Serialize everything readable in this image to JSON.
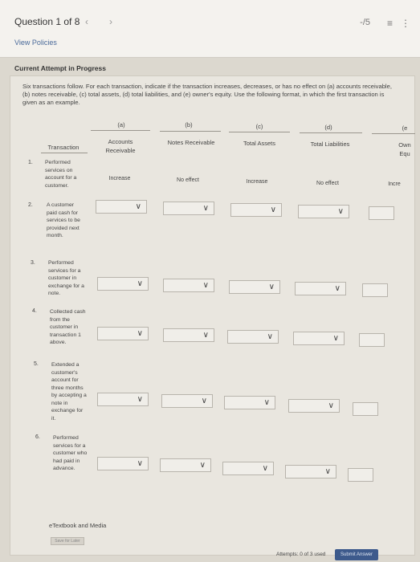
{
  "header": {
    "question_label": "Question 1 of 8",
    "view_policies": "View Policies",
    "score": "-/5",
    "list_icon": "list-icon",
    "more_icon": "more-vertical-icon"
  },
  "attempt_label": "Current Attempt in Progress",
  "instructions": "Six transactions follow. For each transaction, indicate if the transaction increases, decreases, or has no effect on (a) accounts receivable, (b) notes receivable, (c) total assets, (d) total liabilities, and (e) owner's equity. Use the following format, in which the first transaction is given as an example.",
  "columns": {
    "transaction": "Transaction",
    "a_letter": "(a)",
    "a_label": "Accounts Receivable",
    "b_letter": "(b)",
    "b_label": "Notes Receivable",
    "c_letter": "(c)",
    "c_label": "Total Assets",
    "d_letter": "(d)",
    "d_label": "Total Liabilities",
    "e_letter": "(e",
    "e_label": "Own Equ"
  },
  "rows": [
    {
      "num": "1.",
      "text": "Performed services on account for a customer."
    },
    {
      "num": "2.",
      "text": "A customer paid cash for services to be provided next month."
    },
    {
      "num": "3.",
      "text": "Performed services for a customer in exchange for a note."
    },
    {
      "num": "4.",
      "text": "Collected cash from the customer in transaction 1 above."
    },
    {
      "num": "5.",
      "text": "Extended a customer's account for three months by accepting a note in exchange for it."
    },
    {
      "num": "6.",
      "text": "Performed services for a customer who had paid in advance."
    }
  ],
  "example": {
    "a": "Increase",
    "b": "No effect",
    "c": "Increase",
    "d": "No effect",
    "e": "Incre"
  },
  "footer": {
    "etextbook": "eTextbook and Media",
    "save_later": "Save for Later",
    "attempts": "Attempts: 0 of 3 used",
    "submit": "Submit Answer"
  }
}
